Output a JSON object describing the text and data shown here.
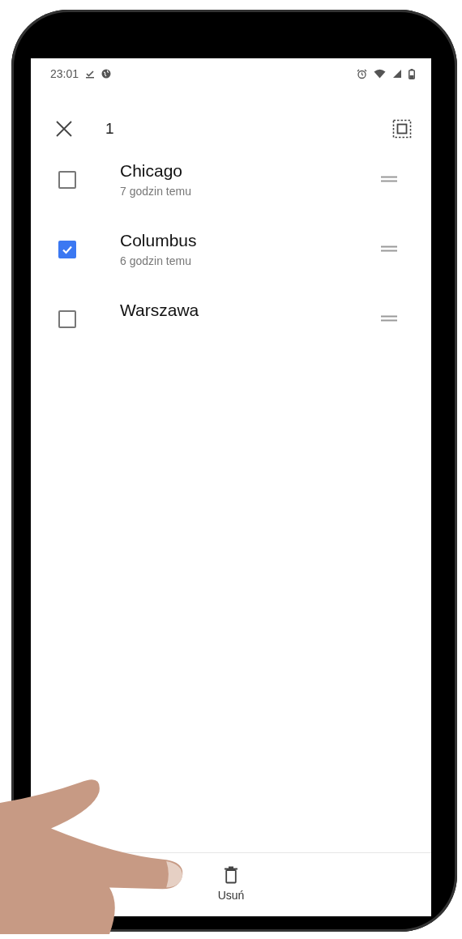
{
  "status_bar": {
    "time": "23:01"
  },
  "header": {
    "selection_count": "1"
  },
  "locations": [
    {
      "name": "Chicago",
      "subtitle": "7 godzin temu",
      "checked": false
    },
    {
      "name": "Columbus",
      "subtitle": "6 godzin temu",
      "checked": true
    },
    {
      "name": "Warszawa",
      "checked": false
    }
  ],
  "bottom_bar": {
    "delete_label": "Usuń"
  }
}
